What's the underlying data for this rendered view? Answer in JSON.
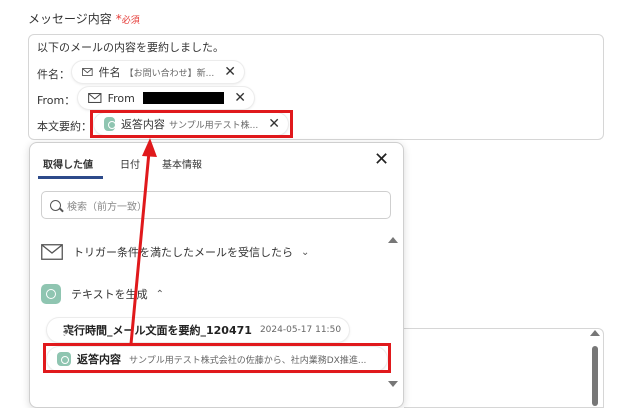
{
  "field": {
    "label": "メッセージ内容",
    "required_star": "*",
    "required_text": "必須"
  },
  "message": {
    "intro": "以下のメールの内容を要約しました。",
    "subject_label": "件名：",
    "subject_chip": {
      "main": "件名",
      "sub": "【お問い合わせ】新..."
    },
    "from_label": "From：",
    "from_chip": {
      "main": "From"
    },
    "body_label": "本文要約：",
    "body_chip": {
      "main": "返答内容",
      "sub": "サンプル用テスト株..."
    }
  },
  "panel": {
    "tabs": [
      "取得した値",
      "日付",
      "基本情報"
    ],
    "active_tab": 0,
    "search_placeholder": "検索（前方一致）",
    "trigger_section": "トリガー条件を満たしたメールを受信したら",
    "text_section": "テキストを生成",
    "result_exec": {
      "main": "実行時間_メール文面を要約_120471",
      "sub": "2024-05-17 11:50"
    },
    "result_reply": {
      "main": "返答内容",
      "sub": "サンプル用テスト株式会社の佐藤から、社内業務DX推進..."
    }
  },
  "icons": {
    "mail": "mail-icon",
    "close": "close-icon",
    "search": "search-icon",
    "chatgpt": "chatgpt-icon",
    "chevron_down": "chevron-down-icon",
    "chevron_up": "chevron-up-icon"
  },
  "colors": {
    "highlight_red": "#e0191c",
    "tab_underline": "#2d4a8a",
    "required": "#e53935",
    "chatgpt_green": "#8fc5b1"
  }
}
